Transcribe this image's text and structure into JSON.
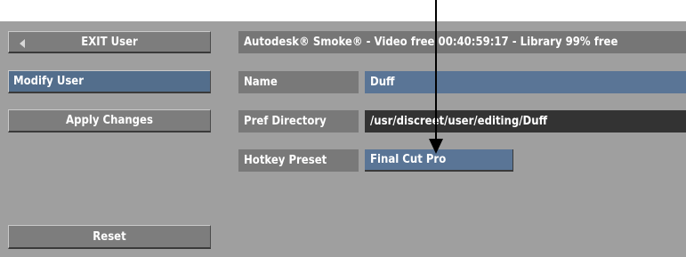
{
  "left_menu": {
    "exit_label": "EXIT User",
    "modify_label": "Modify User",
    "apply_label": "Apply Changes",
    "reset_label": "Reset"
  },
  "status_bar": {
    "text": "Autodesk® Smoke® - Video free 00:40:59:17 - Library 99% free"
  },
  "fields": {
    "name": {
      "label": "Name",
      "value": "Duff"
    },
    "pref_directory": {
      "label": "Pref Directory",
      "value": "/usr/discreet/user/editing/Duff"
    },
    "hotkey_preset": {
      "label": "Hotkey Preset",
      "value": "Final Cut Pro"
    }
  },
  "icons": {
    "exit": "left-triangle-icon",
    "callout": "callout-arrow"
  },
  "colors": {
    "panel": "#9f9f9f",
    "grey_button": "#7d7d7d",
    "blue_selected": "#536e8c",
    "dark_field": "#333333"
  }
}
